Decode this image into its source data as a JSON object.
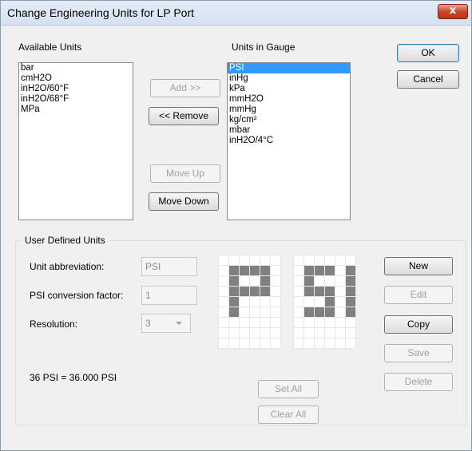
{
  "window": {
    "title": "Change Engineering Units for LP Port",
    "close_glyph": "x"
  },
  "available": {
    "label": "Available Units",
    "items": [
      "bar",
      "cmH2O",
      "inH2O/60°F",
      "inH2O/68°F",
      "MPa"
    ]
  },
  "gauge": {
    "label": "Units in Gauge",
    "items": [
      "PSI",
      "inHg",
      "kPa",
      "mmH2O",
      "mmHg",
      "kg/cm²",
      "mbar",
      "inH2O/4°C"
    ],
    "selected_index": 0
  },
  "buttons": {
    "ok": "OK",
    "cancel": "Cancel",
    "add": "Add >>",
    "remove": "<< Remove",
    "move_up": "Move Up",
    "move_down": "Move Down",
    "new": "New",
    "edit": "Edit",
    "copy": "Copy",
    "save": "Save",
    "delete": "Delete",
    "set_all": "Set All",
    "clear_all": "Clear All"
  },
  "user_defined": {
    "group_label": "User Defined Units",
    "abbr_label": "Unit abbreviation:",
    "abbr_value": "PSI",
    "factor_label": "PSI conversion factor:",
    "factor_value": "1",
    "resolution_label": "Resolution:",
    "resolution_value": "3",
    "conversion_text": "36 PSI = 36.000 PSI"
  },
  "bitmap": {
    "colors": {
      "on": "#808080",
      "off": "#ffffff",
      "line": "#e6e6e6"
    },
    "left_rows": [
      "000000",
      "011110",
      "010010",
      "011110",
      "010000",
      "010000",
      "000000",
      "000000",
      "000000"
    ],
    "right_rows": [
      "000000",
      "011101",
      "010001",
      "011101",
      "000101",
      "011101",
      "000000",
      "000000",
      "000000"
    ]
  }
}
